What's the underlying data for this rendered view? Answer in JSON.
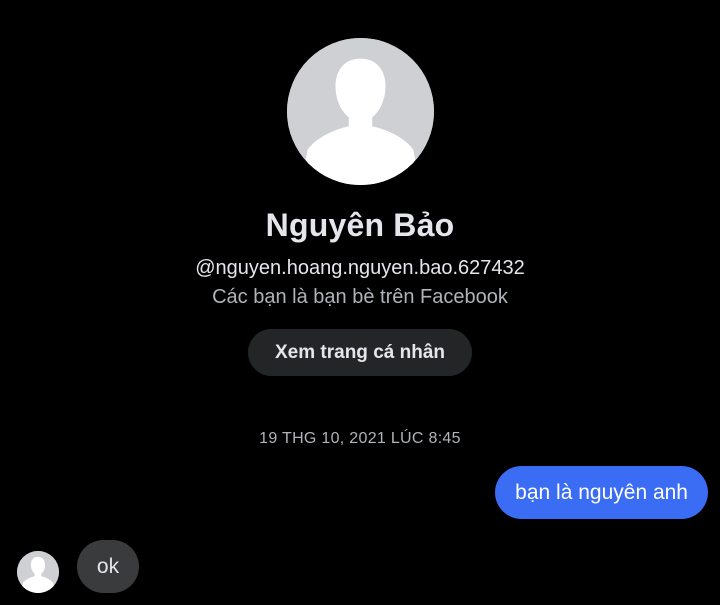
{
  "profile": {
    "avatar_icon": "default-person-silhouette-icon",
    "name": "Nguyên Bảo",
    "username": "@nguyen.hoang.nguyen.bao.627432",
    "relation": "Các bạn là bạn bè trên Facebook",
    "view_profile_label": "Xem trang cá nhân"
  },
  "conversation": {
    "timestamp": "19 THG 10, 2021 LÚC 8:45",
    "messages": [
      {
        "direction": "outgoing",
        "text": "bạn là nguyên anh"
      },
      {
        "direction": "incoming",
        "text": "ok"
      }
    ]
  },
  "colors": {
    "background": "#000000",
    "outgoing_bubble": "#3a6cf4",
    "incoming_bubble": "#3a3b3c",
    "button_background": "#242526",
    "avatar_background": "#ced0d4",
    "secondary_text": "#b0b3b8"
  }
}
